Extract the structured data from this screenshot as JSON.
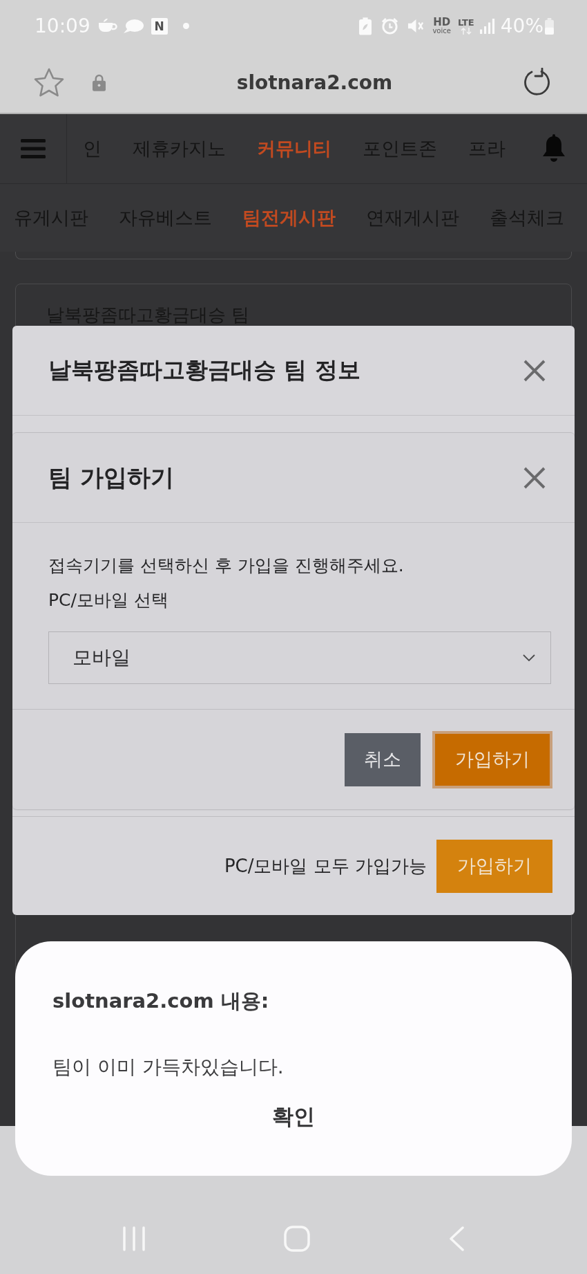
{
  "status_bar": {
    "time": "10:09",
    "app_badge": "N",
    "hd_label": "HD",
    "hd_sub": "voice",
    "network": "LTE",
    "battery": "40%"
  },
  "address_bar": {
    "url": "slotnara2.com"
  },
  "main_nav": {
    "items": [
      {
        "label": "인",
        "selected": false
      },
      {
        "label": "제휴카지노",
        "selected": false
      },
      {
        "label": "커뮤니티",
        "selected": true
      },
      {
        "label": "포인트존",
        "selected": false
      },
      {
        "label": "프라",
        "selected": false
      }
    ]
  },
  "sub_nav": {
    "items": [
      {
        "label": "유게시판",
        "selected": false
      },
      {
        "label": "자유베스트",
        "selected": false
      },
      {
        "label": "팀전게시판",
        "selected": true
      },
      {
        "label": "연재게시판",
        "selected": false
      },
      {
        "label": "출석체크",
        "selected": false
      }
    ]
  },
  "background_card": {
    "title": "날북팡좀따고황금대승 팀"
  },
  "team_modal": {
    "title": "날북팡좀따고황금대승 팀 정보",
    "footer_note": "PC/모바일 모두 가입가능",
    "button": {
      "label": "가입하기",
      "kind": "confirm",
      "focused": false
    }
  },
  "join_modal": {
    "title": "팀 가입하기",
    "instruction": "접속기기를 선택하신 후 가입을 진행해주세요.",
    "select_label": "PC/모바일 선택",
    "select_value": "모바일",
    "buttons": [
      {
        "label": "취소",
        "kind": "cancel",
        "focused": false
      },
      {
        "label": "가입하기",
        "kind": "confirm",
        "focused": true
      }
    ]
  },
  "alert": {
    "title": "slotnara2.com 내용:",
    "message": "팀이 이미 가득차있습니다.",
    "button": "확인"
  }
}
